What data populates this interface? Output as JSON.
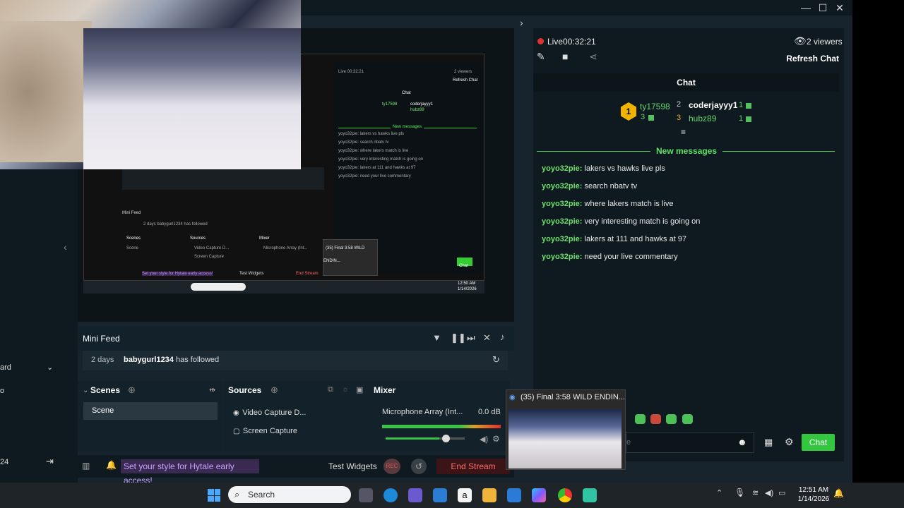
{
  "window": {
    "minimize": "—",
    "maximize": "☐",
    "close": "✕"
  },
  "left_sidebar": {
    "item1": "ard",
    "item2": "o",
    "item3": "24"
  },
  "stream": {
    "live_label": "Live",
    "elapsed": "00:32:21",
    "viewers": "2 viewers",
    "refresh_label": "Refresh Chat"
  },
  "chat": {
    "title": "Chat",
    "leaderboard": {
      "first": {
        "rank": "1",
        "name": "ty17598",
        "count": "3"
      },
      "second": {
        "rank": "2",
        "name": "coderjayyy1",
        "count": "1"
      },
      "third": {
        "rank": "3",
        "name": "hubz89",
        "count": "1"
      }
    },
    "new_messages_label": "New messages",
    "messages": [
      {
        "user": "yoyo32pie:",
        "text": "lakers vs hawks live pls"
      },
      {
        "user": "yoyo32pie:",
        "text": "search nbatv tv"
      },
      {
        "user": "yoyo32pie:",
        "text": "where lakers match is live"
      },
      {
        "user": "yoyo32pie:",
        "text": "very interesting match is going on"
      },
      {
        "user": "yoyo32pie:",
        "text": "lakers at 111 and hawks at 97"
      },
      {
        "user": "yoyo32pie:",
        "text": "need your live commentary"
      }
    ],
    "input_partial": "e",
    "send_label": "Chat"
  },
  "mini_feed": {
    "title": "Mini Feed",
    "row": {
      "time": "2 days",
      "user": "babygurl1234",
      "action": "has followed"
    }
  },
  "scenes": {
    "title": "Scenes",
    "items": [
      "Scene"
    ]
  },
  "sources": {
    "title": "Sources",
    "items": [
      "Video Capture D...",
      "Screen Capture"
    ]
  },
  "mixer": {
    "title": "Mixer",
    "device": "Microphone Array (Int...",
    "level": "0.0 dB",
    "level_fraction": 0.68
  },
  "footer": {
    "promo": "Set your style for Hytale early access!",
    "test_widgets": "Test Widgets",
    "rec": "REC",
    "end_stream": "End Stream"
  },
  "browser_popup": {
    "title": "(35) Final 3:58 WILD ENDIN..."
  },
  "taskbar": {
    "search_placeholder": "Search",
    "time": "12:51 AM",
    "date": "1/14/2026"
  },
  "nested": {
    "live": "Live 00:32:21",
    "viewers": "2 viewers",
    "refresh": "Refresh Chat",
    "chat": "Chat",
    "lb1": "ty17598",
    "lb2": "coderjayyy1",
    "lb3": "hubz89",
    "new": "New messages",
    "messages": [
      "yoyo32pie: lakers vs hawks live pls",
      "yoyo32pie: search nbatv tv",
      "yoyo32pie: where lakers match is live",
      "yoyo32pie: very interesting match is going on",
      "yoyo32pie: lakers at 111 and hawks at 97",
      "yoyo32pie: need your live commentary"
    ],
    "feed": "Mini Feed",
    "feed_row": "2 days  babygurl1234  has followed",
    "scenes": "Scenes",
    "sources": "Sources",
    "mixer": "Mixer",
    "scene": "Scene",
    "src1": "Video Capture D...",
    "src2": "Screen Capture",
    "mic": "Microphone Array (Int...",
    "promo": "Set your style for Hytale early access!",
    "test": "Test Widgets",
    "end": "End Stream",
    "popup": "(35) Final 3:58 WILD ENDIN...",
    "send": "Chat",
    "clock_time": "12:50 AM",
    "clock_date": "1/14/2026"
  },
  "colors": {
    "accent_green": "#33c63f",
    "live_red": "#e03131",
    "panel": "#0f1a20"
  }
}
